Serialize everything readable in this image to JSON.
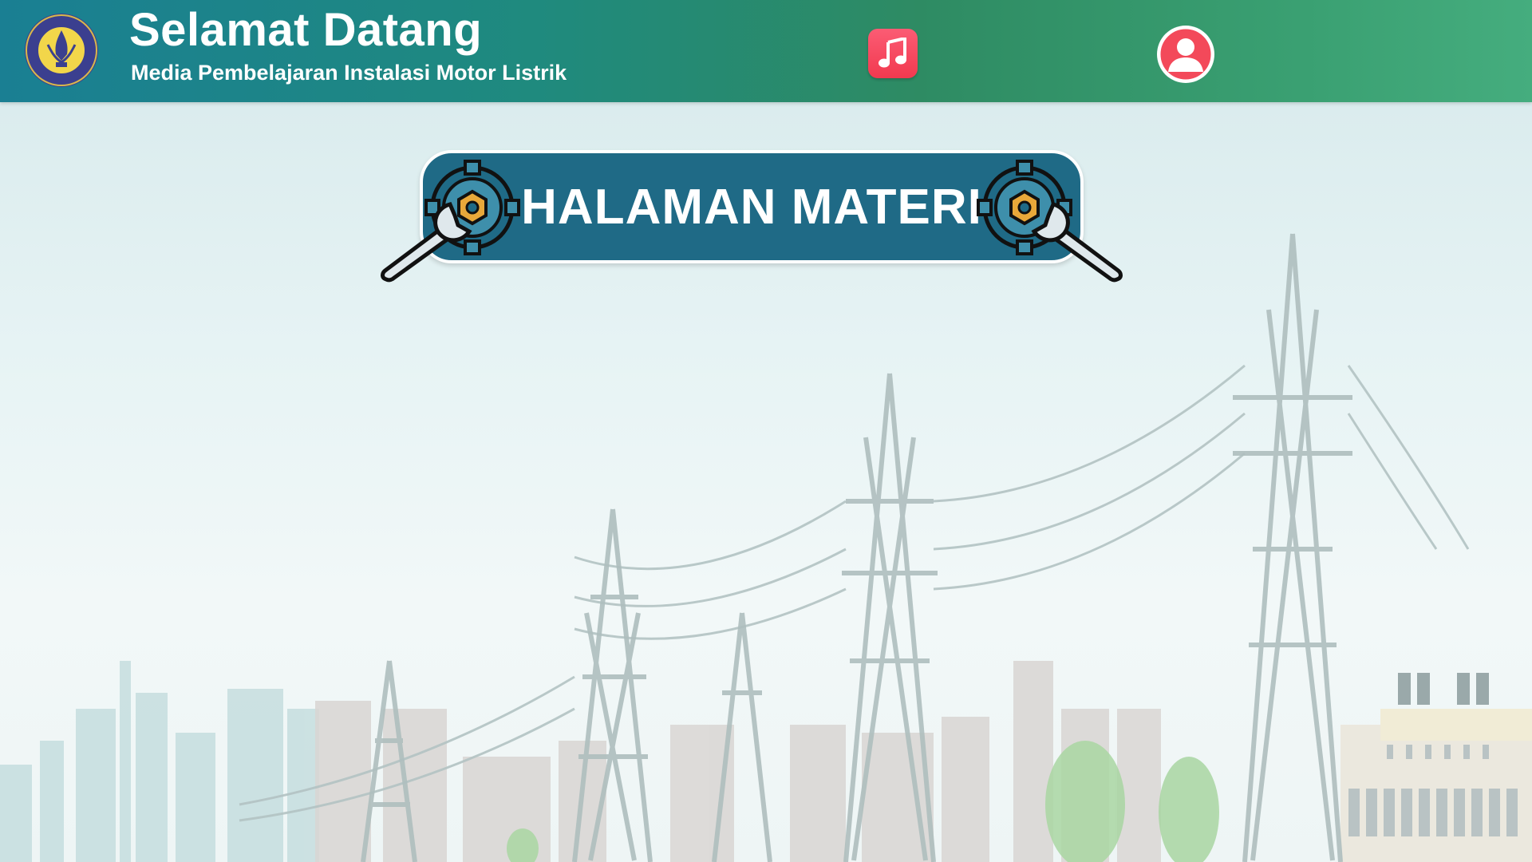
{
  "header": {
    "title": "Selamat Datang",
    "subtitle": "Media Pembelajaran Instalasi Motor Listrik",
    "logo_icon": "university-seal-logo",
    "music_icon": "music-note-icon",
    "user_icon": "user-profile-icon"
  },
  "banner": {
    "label": "HALAMAN MATERI",
    "left_icon": "gear-wrench-icon",
    "right_icon": "gear-wrench-icon"
  },
  "colors": {
    "header_start": "#1a7f93",
    "header_end": "#45ad7e",
    "banner_fill": "#1f6a86",
    "music_button": "#f2394f",
    "gear_hub": "#e8a83a"
  }
}
